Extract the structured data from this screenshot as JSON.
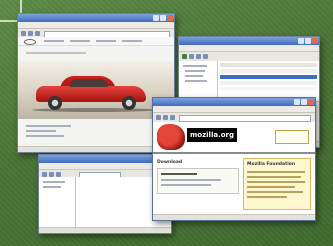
{
  "mozilla_site": {
    "logo_text": "mozilla.org",
    "download_heading": "Download",
    "foundation_heading": "Mozilla Foundation"
  },
  "colors": {
    "background": "#4e7a3a",
    "titlebar": "#3f6cc0",
    "car": "#c8241e",
    "mozilla_red": "#e14638"
  }
}
